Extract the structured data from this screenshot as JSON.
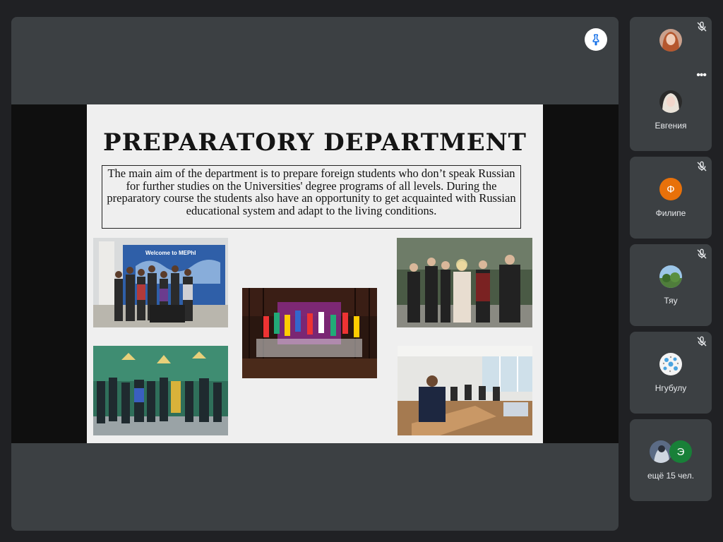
{
  "slide": {
    "title": "PREPARATORY DEPARTMENT",
    "body": "The main aim of the department is to prepare foreign students who don’t speak Russian for further studies on the Universities' degree programs of all levels. During the preparatory course the students also have an opportunity to get acquainted with Russian educational system and adapt to the living conditions.",
    "photo1_sign": "Welcome  to  MEPhI"
  },
  "participants": [
    {
      "name": "",
      "muted": true
    },
    {
      "name": "Евгения",
      "muted": false,
      "has_more": true
    },
    {
      "name": "Филипе",
      "muted": true,
      "initial": "Ф",
      "color": "#e8710a"
    },
    {
      "name": "Тяу",
      "muted": true
    },
    {
      "name": "Нгубулу",
      "muted": true
    }
  ],
  "others": {
    "label": "ещё 15 чел.",
    "initial": "Э",
    "color": "#188038"
  },
  "more_glyph": "•••"
}
